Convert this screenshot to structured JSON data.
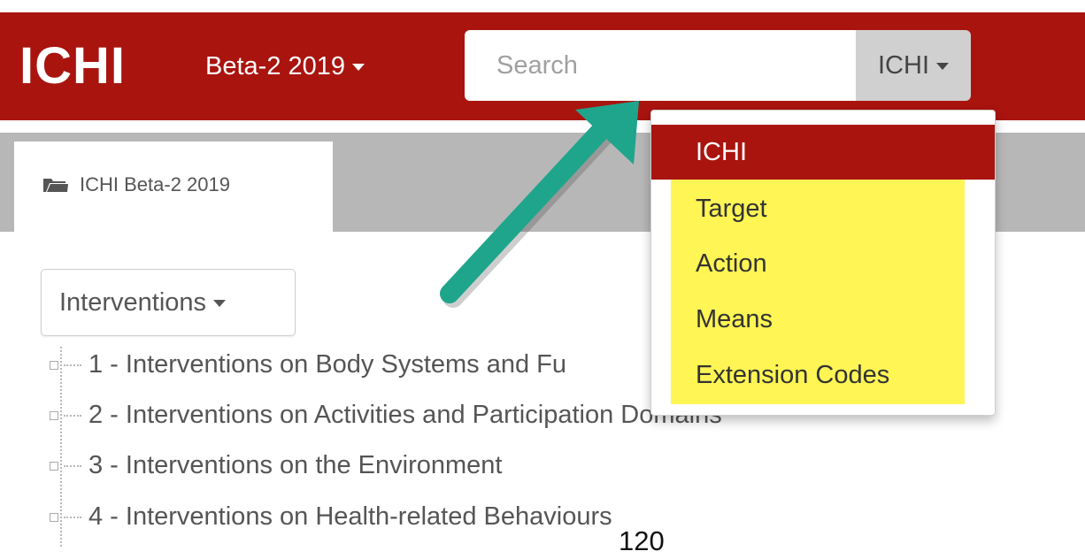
{
  "navbar": {
    "brand": "ICHI",
    "version_label": "Beta-2 2019",
    "search_placeholder": "Search",
    "scope_label": "ICHI"
  },
  "tab": {
    "label": "ICHI Beta-2 2019"
  },
  "interventions_dropdown": {
    "label": "Interventions"
  },
  "tree": {
    "items": [
      "1 - Interventions on Body Systems and Fu",
      "2 - Interventions on Activities and Participation Domains",
      "3 - Interventions on the Environment",
      "4 - Interventions on Health-related Behaviours"
    ]
  },
  "scope_menu": {
    "items": [
      "ICHI",
      "Target",
      "Action",
      "Means",
      "Extension Codes"
    ],
    "selected": "ICHI"
  },
  "page_number": "120",
  "colors": {
    "brand_red": "#a9140f",
    "highlight_yellow": "#fff554",
    "arrow_teal": "#1fa58c"
  },
  "icons": {
    "folder": "folder-open-icon",
    "annotation_arrow": "arrow-icon"
  }
}
